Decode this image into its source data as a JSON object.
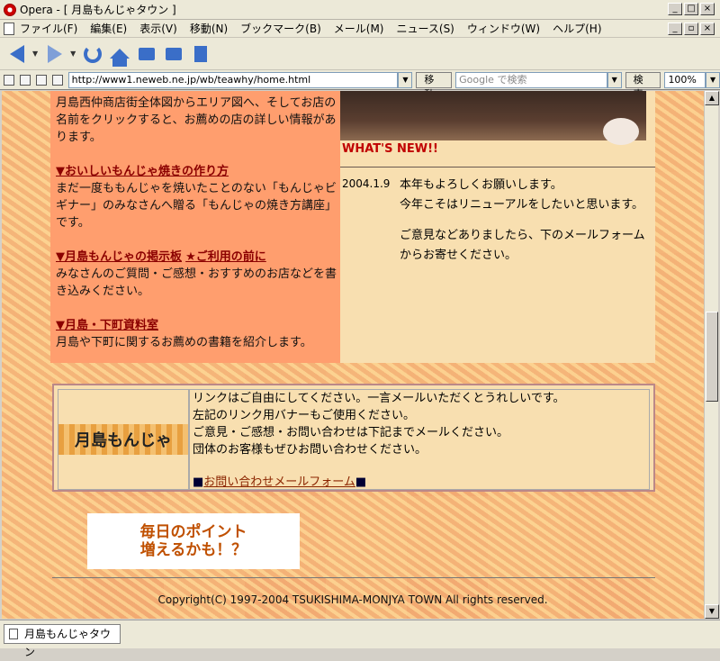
{
  "window": {
    "title": "Opera - [ 月島もんじゃタウン ]"
  },
  "menu": {
    "items": [
      "ファイル(F)",
      "編集(E)",
      "表示(V)",
      "移動(N)",
      "ブックマーク(B)",
      "メール(M)",
      "ニュース(S)",
      "ウィンドウ(W)",
      "ヘルプ(H)"
    ]
  },
  "toolbar": {
    "buttons": [
      "back-icon",
      "forward-icon",
      "reload-icon",
      "home-icon",
      "bookmarks-icon",
      "print-icon",
      "notepad-icon"
    ]
  },
  "address_bar": {
    "url": "http://www1.neweb.ne.jp/wb/teawhy/home.html",
    "go_label": "移動",
    "search_placeholder": "Google で検索",
    "search_label": "検索",
    "zoom": "100%"
  },
  "left_panel": {
    "intro": "月島西仲商店街全体図からエリア図へ、そしてお店の名前をクリックすると、お薦めの店の詳しい情報があります。",
    "sections": [
      {
        "title": "▼おいしいもんじゃ焼きの作り方",
        "text": "まだ一度ももんじゃを焼いたことのない「もんじゃビギナー」のみなさんへ贈る「もんじゃの焼き方講座」です。"
      },
      {
        "title": "▼月島もんじゃの掲示板",
        "title2": "★ご利用の前に",
        "text": "みなさんのご質問・ご感想・おすすめのお店などを書き込みください。"
      },
      {
        "title": "▼月島・下町資料室",
        "text": "月島や下町に関するお薦めの書籍を紹介します。"
      }
    ]
  },
  "news": {
    "heading": "WHAT'S NEW!!",
    "date": "2004.1.9",
    "body": [
      "本年もよろしくお願いします。",
      "今年こそはリニューアルをしたいと思います。",
      "ご意見などありましたら、下のメールフォームからお寄せください。"
    ]
  },
  "links_box": {
    "banner_text": "月島もんじゃ",
    "lines": [
      "リンクはご自由にしてください。一言メールいただくとうれしいです。",
      "左記のリンク用バナーもご使用ください。",
      "ご意見・ご感想・お問い合わせは下記までメールください。",
      "団体のお客様もぜひお問い合わせください。"
    ],
    "contact_link": "お問い合わせメールフォーム"
  },
  "point_banner": {
    "line1": "毎日のポイント",
    "line2": "増えるかも！？"
  },
  "footer": {
    "copyright": "Copyright(C) 1997-2004 TSUKISHIMA-MONJYA TOWN All rights reserved."
  },
  "status_bar": {
    "tab_title": "月島もんじゃタウン"
  }
}
